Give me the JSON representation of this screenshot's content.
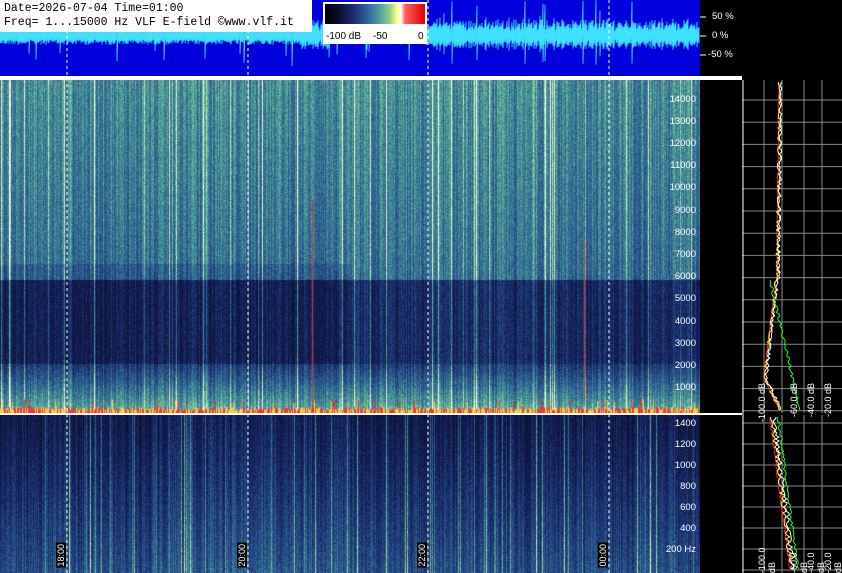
{
  "info": {
    "line1": "Date=2026-07-04 Time=01:00",
    "line2": "Freq= 1...15000 Hz   VLF E-field ©www.vlf.it"
  },
  "colorbar": {
    "labels": [
      "-100 dB",
      "-50",
      "0"
    ]
  },
  "amplitude_axis": [
    "50 %",
    "0 %",
    "-50 %"
  ],
  "upper_freq_axis": [
    "14000",
    "13000",
    "12000",
    "11000",
    "10000",
    "9000",
    "8000",
    "7000",
    "6000",
    "5000",
    "4000",
    "3000",
    "2000",
    "1000"
  ],
  "lower_freq_axis": [
    "1400",
    "1200",
    "1000",
    "800",
    "600",
    "400",
    "200 Hz"
  ],
  "time_labels": [
    "18:00",
    "20:00",
    "22:00",
    "00:00"
  ],
  "upper_db_labels": [
    "-100.0 dB",
    "-60.0 dB",
    "-40.0 dB",
    "-20.0 dB"
  ],
  "lower_db_labels": [
    "-100.0 dB",
    "-60.0 dB",
    "-40.0 dB",
    "-20.0 dB"
  ],
  "colors": {
    "waveform_bg": "#0000dd",
    "waveform_trace": "#40e0ff",
    "spec_low": "#101840",
    "spec_mid": "#3a6a9a",
    "spec_high": "#8fd0a0",
    "spectrum_white": "#ffffff",
    "spectrum_red": "#ff2020",
    "spectrum_green": "#20ff20",
    "spectrum_yellow": "#ffff40"
  }
}
